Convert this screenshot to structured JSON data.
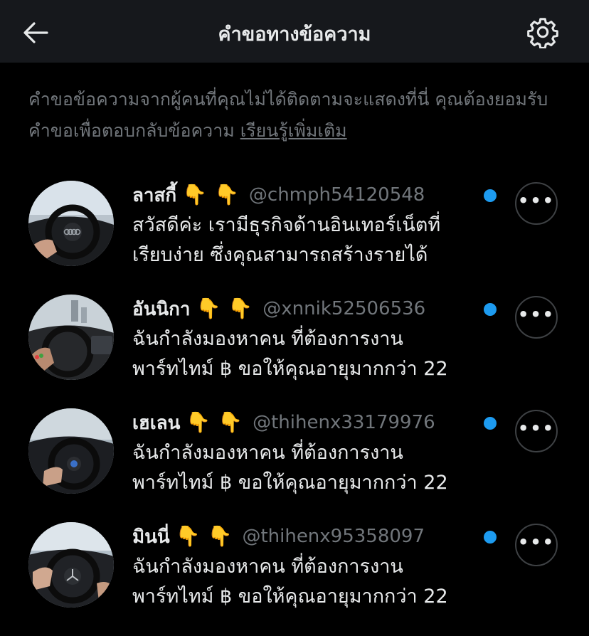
{
  "header": {
    "title": "คำขอทางข้อความ",
    "back_icon": "back-arrow-icon",
    "settings_icon": "gear-icon"
  },
  "info": {
    "text": "คำขอข้อความจากผู้คนที่คุณไม่ได้ติดตามจะแสดงที่นี่ คุณต้องยอมรับคำขอเพื่อตอบกลับข้อความ",
    "link": "เรียนรู้เพิ่มเติม"
  },
  "colors": {
    "background": "#000000",
    "header_bg": "#16181c",
    "unread_dot": "#1d9bf0",
    "secondary_text": "#71767b"
  },
  "requests": [
    {
      "name": "ลาสกี้",
      "emojis": "👇",
      "handle": "@chmph54120548",
      "preview_line1": "สวัสดีค่ะ เรามีธุรกิจด้านอินเทอร์เน็ตที่",
      "preview_line2": "เรียบง่าย ซึ่งคุณสามารถสร้างรายได้",
      "unread": true
    },
    {
      "name": "อันนิกา",
      "emojis": "👇",
      "handle": "@xnnik52506536",
      "preview_line1": "ฉันกำลังมองหาคน ที่ต้องการงาน",
      "preview_line2": "พาร์ทไทม์ ฿ ขอให้คุณอายุมากกว่า 22",
      "unread": true
    },
    {
      "name": "เฮเลน",
      "emojis": "👇",
      "handle": "@thihenx33179976",
      "preview_line1": "ฉันกำลังมองหาคน ที่ต้องการงาน",
      "preview_line2": "พาร์ทไทม์ ฿ ขอให้คุณอายุมากกว่า 22",
      "unread": true
    },
    {
      "name": "มินนี่",
      "emojis": "👇",
      "handle": "@thihenx95358097",
      "preview_line1": "ฉันกำลังมองหาคน ที่ต้องการงาน",
      "preview_line2": "พาร์ทไทม์ ฿ ขอให้คุณอายุมากกว่า 22",
      "unread": true
    }
  ]
}
